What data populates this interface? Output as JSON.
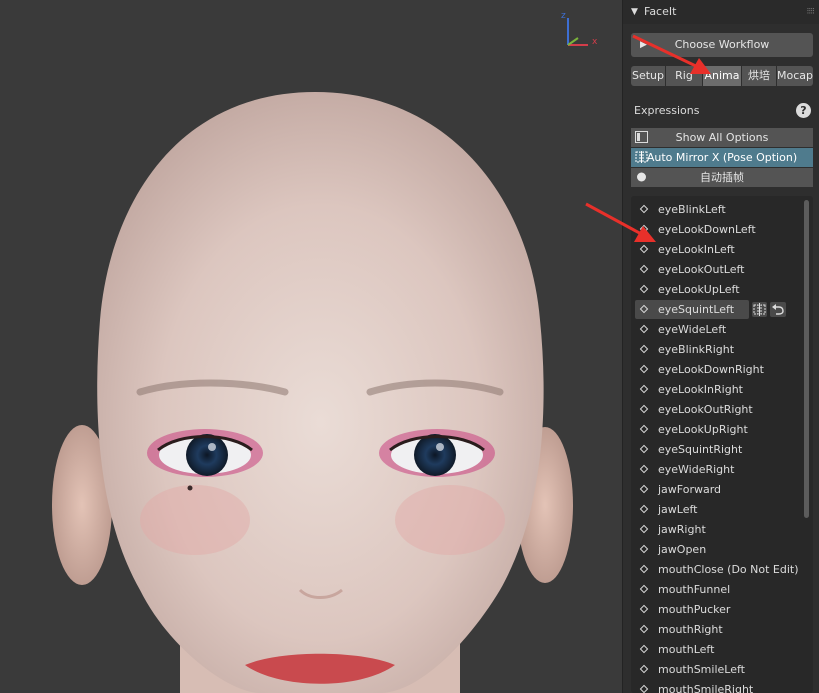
{
  "panel": {
    "title": "FaceIt"
  },
  "workflow_button": "Choose Workflow",
  "tabs": [
    {
      "label": "Setup",
      "active": false
    },
    {
      "label": "Rig",
      "active": false
    },
    {
      "label": "Anima",
      "active": true
    },
    {
      "label": "烘培",
      "active": false
    },
    {
      "label": "Mocap",
      "active": false
    }
  ],
  "expressions": {
    "title": "Expressions",
    "help_label": "?",
    "options": [
      {
        "label": "Show All Options",
        "icon": "panel-icon",
        "active": false
      },
      {
        "label": "Auto Mirror X (Pose Option)",
        "icon": "mirror-icon",
        "active": true
      },
      {
        "label": "自动插帧",
        "icon": "record-dot-icon",
        "active": false
      }
    ],
    "items": [
      "eyeBlinkLeft",
      "eyeLookDownLeft",
      "eyeLookInLeft",
      "eyeLookOutLeft",
      "eyeLookUpLeft",
      "eyeSquintLeft",
      "eyeWideLeft",
      "eyeBlinkRight",
      "eyeLookDownRight",
      "eyeLookInRight",
      "eyeLookOutRight",
      "eyeLookUpRight",
      "eyeSquintRight",
      "eyeWideRight",
      "jawForward",
      "jawLeft",
      "jawRight",
      "jawOpen",
      "mouthClose (Do Not Edit)",
      "mouthFunnel",
      "mouthPucker",
      "mouthRight",
      "mouthLeft",
      "mouthSmileLeft",
      "mouthSmileRight"
    ],
    "selected_item": "eyeSquintLeft"
  },
  "gizmo": {
    "z_label": "z",
    "x_label": "x"
  },
  "colors": {
    "accent_active": "#4f7b8d",
    "annotation_arrow": "#e8302a",
    "axis_x": "#d33d4a",
    "axis_y": "#7bb33b",
    "axis_z": "#3d6fd3"
  }
}
